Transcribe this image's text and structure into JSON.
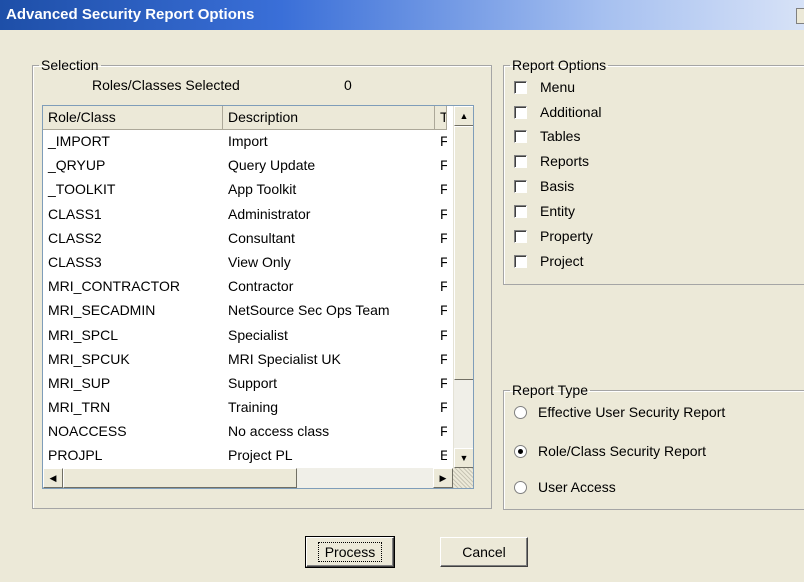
{
  "window": {
    "title": "Advanced Security Report Options"
  },
  "selection": {
    "legend": "Selection",
    "count_label": "Roles/Classes Selected",
    "count_value": "0",
    "columns": [
      "Role/Class",
      "Description",
      "T"
    ],
    "rows": [
      {
        "role": "_IMPORT",
        "description": "Import",
        "t": "F"
      },
      {
        "role": "_QRYUP",
        "description": "Query Update",
        "t": "F"
      },
      {
        "role": "_TOOLKIT",
        "description": "App Toolkit",
        "t": "F"
      },
      {
        "role": "CLASS1",
        "description": "Administrator",
        "t": "F"
      },
      {
        "role": "CLASS2",
        "description": "Consultant",
        "t": "F"
      },
      {
        "role": "CLASS3",
        "description": "View Only",
        "t": "F"
      },
      {
        "role": "MRI_CONTRACTOR",
        "description": "Contractor",
        "t": "F"
      },
      {
        "role": "MRI_SECADMIN",
        "description": "NetSource Sec Ops Team",
        "t": "F"
      },
      {
        "role": "MRI_SPCL",
        "description": "Specialist",
        "t": "F"
      },
      {
        "role": "MRI_SPCUK",
        "description": "MRI Specialist UK",
        "t": "F"
      },
      {
        "role": "MRI_SUP",
        "description": "Support",
        "t": "F"
      },
      {
        "role": "MRI_TRN",
        "description": "Training",
        "t": "F"
      },
      {
        "role": "NOACCESS",
        "description": "No access class",
        "t": "F"
      },
      {
        "role": "PROJPL",
        "description": "Project PL",
        "t": "E"
      }
    ]
  },
  "report_options": {
    "legend": "Report Options",
    "items": [
      {
        "label": "Menu",
        "checked": false
      },
      {
        "label": "Additional",
        "checked": false
      },
      {
        "label": "Tables",
        "checked": false
      },
      {
        "label": "Reports",
        "checked": false
      },
      {
        "label": "Basis",
        "checked": false
      },
      {
        "label": "Entity",
        "checked": false
      },
      {
        "label": "Property",
        "checked": false
      },
      {
        "label": "Project",
        "checked": false
      }
    ]
  },
  "report_type": {
    "legend": "Report Type",
    "options": [
      {
        "label": "Effective User Security Report",
        "selected": false
      },
      {
        "label": "Role/Class Security Report",
        "selected": true
      },
      {
        "label": "User Access",
        "selected": false
      }
    ]
  },
  "buttons": {
    "process": "Process",
    "cancel": "Cancel"
  },
  "colors": {
    "titlebar_start": "#1e4fa8",
    "dialog_bg": "#ece9d8",
    "list_border": "#7f9db9"
  }
}
